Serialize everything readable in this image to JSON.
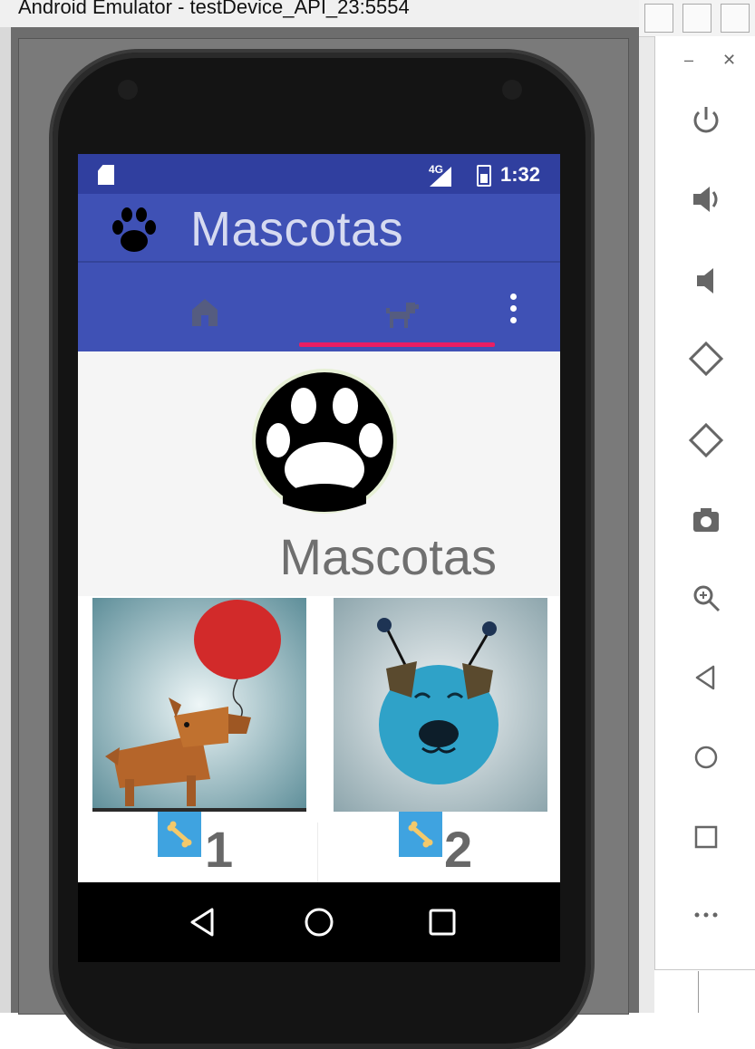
{
  "window": {
    "title": "Android Emulator - testDevice_API_23:5554"
  },
  "status_bar": {
    "network": "4G",
    "time": "1:32"
  },
  "app_bar": {
    "title": "Mascotas"
  },
  "tabs": [
    {
      "icon": "home-icon",
      "selected": false
    },
    {
      "icon": "dog-icon",
      "selected": true
    }
  ],
  "profile": {
    "name": "Mascotas"
  },
  "pets": [
    {
      "photo": "dog-with-balloon",
      "rating_icon": "bone-icon",
      "rating": "1"
    },
    {
      "photo": "blue-dog-with-antennas",
      "rating_icon": "bone-icon",
      "rating": "2"
    }
  ],
  "colors": {
    "status_bar": "#303f9f",
    "app_bar": "#3f51b5",
    "tab_indicator": "#e91e63",
    "rating_badge": "#3fa3e0"
  },
  "emulator_toolbar": [
    "power-icon",
    "volume-up-icon",
    "volume-down-icon",
    "rotate-left-icon",
    "rotate-right-icon",
    "camera-icon",
    "zoom-icon",
    "back-icon",
    "home-icon",
    "overview-icon",
    "more-icon"
  ]
}
